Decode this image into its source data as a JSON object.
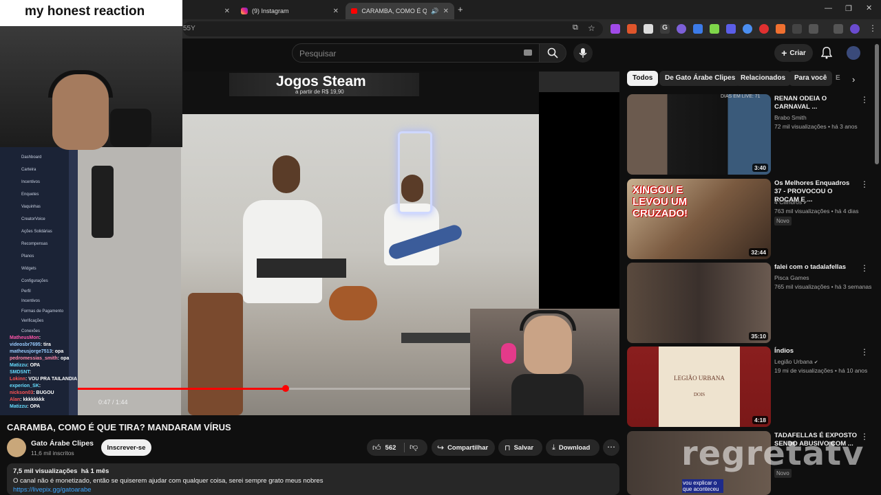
{
  "overlay": {
    "reaction_caption": "my honest reaction",
    "watermark": "regretatv"
  },
  "tabs": [
    {
      "label": "(9) Instagram"
    },
    {
      "label": "CARAMBA, COMO É QUE TI"
    }
  ],
  "address": {
    "partial": "55Y"
  },
  "header": {
    "search_placeholder": "Pesquisar",
    "create_label": "Criar"
  },
  "chips": [
    "Todos",
    "De Gato Árabe Clipes",
    "Relacionados",
    "Para você",
    "E"
  ],
  "embedded": {
    "banner_title": "Jogos Steam",
    "banner_price": "a partir de R$ 19,90",
    "sidebar_menu": [
      "Dashboard",
      "Carteira",
      "Incentivos",
      "Enquetes",
      "Vaquinhas",
      "CreatorVoice",
      "Ações Solidárias",
      "Recompensas",
      "Planos",
      "Widgets",
      "Configurações",
      "Perfil",
      "Incentivos",
      "Formas de Pagamento",
      "Verificações",
      "Conexões"
    ]
  },
  "chat": [
    {
      "user": "MatheusMon",
      "msg": ""
    },
    {
      "user": "videosbr7695",
      "msg": "tira"
    },
    {
      "user": "matheusjorge7513",
      "msg": "opa"
    },
    {
      "user": "pedromessias_smith",
      "msg": "opa"
    },
    {
      "user": "Matizzu",
      "msg": "OPA"
    },
    {
      "user": "SMDSNT",
      "msg": ""
    },
    {
      "user": "Lokinn",
      "msg": "VOU PRA TAILANDIA"
    },
    {
      "user": "experion_SK",
      "msg": ""
    },
    {
      "user": "nickson03",
      "msg": "BUGOU"
    },
    {
      "user": "Alan",
      "msg": "kkkkkkkk"
    },
    {
      "user": "Matizzu",
      "msg": "OPA"
    }
  ],
  "player": {
    "time": "0:47 / 1:44",
    "progress": 0.45
  },
  "video": {
    "title": "CARAMBA, COMO É QUE TIRA? MANDARAM VÍRUS",
    "channel": "Gato Árabe Clipes",
    "subscribers": "11,6 mil inscritos",
    "subscribe_label": "Inscrever-se",
    "likes": "562",
    "share_label": "Compartilhar",
    "save_label": "Salvar",
    "download_label": "Download"
  },
  "description": {
    "stats": "7,5 mil visualizações  há 1 mês",
    "text": "O canal não é monetizado, então se quiserem ajudar com qualquer coisa, serei sempre grato meus nobres",
    "link": "https://livepix.gg/gatoarabe"
  },
  "recommended": [
    {
      "title": "RENAN ODEIA O CARNAVAL ...",
      "channel": "Brabo Smith",
      "meta": "72 mil visualizações • há 3 anos",
      "duration": "3:40",
      "badge": "",
      "thumb_text": "DIAS EM LIVE: 71",
      "verified": false
    },
    {
      "title": "Os Melhores Enquadros 37 - PROVOCOU O ROCAM E ...",
      "channel": "4 Cilindros",
      "meta": "763 mil visualizações • há 4 dias",
      "duration": "32:44",
      "badge": "Novo",
      "thumb_text": "XINGOU E LEVOU UM CRUZADO!",
      "verified": true
    },
    {
      "title": "falei com o tadalafellas",
      "channel": "Pisca Games",
      "meta": "765 mil visualizações • há 3 semanas",
      "duration": "35:10",
      "badge": "",
      "thumb_text": "",
      "verified": false
    },
    {
      "title": "Índios",
      "channel": "Legião Urbana",
      "meta": "19 mi de visualizações • há 10 anos",
      "duration": "4:18",
      "badge": "",
      "thumb_text": "LEGIÃO URBANA",
      "thumb_sub": "DOIS",
      "verified": true
    },
    {
      "title": "TADAFELLAS É EXPOSTO SENDO ABUSIVO COM ...",
      "channel": "",
      "meta": "",
      "duration": "",
      "badge": "Novo",
      "thumb_text": "vou explicar o que aconteceu",
      "verified": false
    }
  ],
  "colors": {
    "accent_red": "#ff0000",
    "chip_active": "#f1f1f1"
  }
}
